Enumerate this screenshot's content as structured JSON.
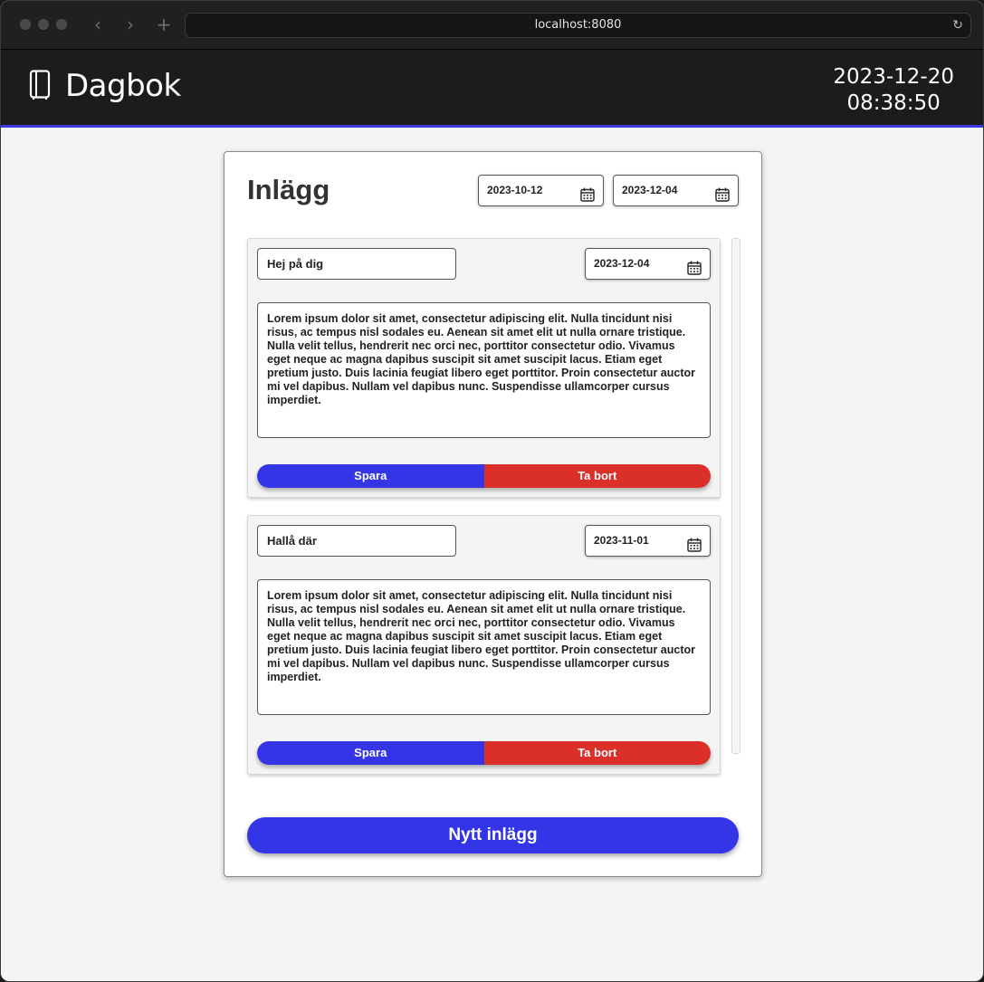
{
  "browser": {
    "url": "localhost:8080",
    "back_icon": "‹",
    "forward_icon": "›",
    "new_tab_icon": "+",
    "reload_icon": "↻"
  },
  "header": {
    "title": "Dagbok",
    "date": "2023-12-20",
    "time": "08:38:50"
  },
  "main": {
    "title": "Inlägg",
    "filter_from": "2023-10-12",
    "filter_to": "2023-12-04",
    "entries": [
      {
        "title": "Hej på dig",
        "date": "2023-12-04",
        "body": "Lorem ipsum dolor sit amet, consectetur adipiscing elit. Nulla tincidunt nisi risus, ac tempus nisl sodales eu. Aenean sit amet elit ut nulla ornare tristique. Nulla velit tellus, hendrerit nec orci nec, porttitor consectetur odio. Vivamus eget neque ac magna dapibus suscipit sit amet suscipit lacus. Etiam eget pretium justo. Duis lacinia feugiat libero eget porttitor. Proin consectetur auctor mi vel dapibus. Nullam vel dapibus nunc. Suspendisse ullamcorper cursus imperdiet.",
        "save_label": "Spara",
        "delete_label": "Ta bort"
      },
      {
        "title": "Hallå där",
        "date": "2023-11-01",
        "body": "Lorem ipsum dolor sit amet, consectetur adipiscing elit. Nulla tincidunt nisi risus, ac tempus nisl sodales eu. Aenean sit amet elit ut nulla ornare tristique. Nulla velit tellus, hendrerit nec orci nec, porttitor consectetur odio. Vivamus eget neque ac magna dapibus suscipit sit amet suscipit lacus. Etiam eget pretium justo. Duis lacinia feugiat libero eget porttitor. Proin consectetur auctor mi vel dapibus. Nullam vel dapibus nunc. Suspendisse ullamcorper cursus imperdiet.",
        "save_label": "Spara",
        "delete_label": "Ta bort"
      }
    ],
    "new_entry_label": "Nytt inlägg"
  },
  "colors": {
    "primary": "#3535e8",
    "danger": "#db2f2a",
    "header_bg": "#1c1c1c",
    "accent_line": "#3a3adf"
  }
}
